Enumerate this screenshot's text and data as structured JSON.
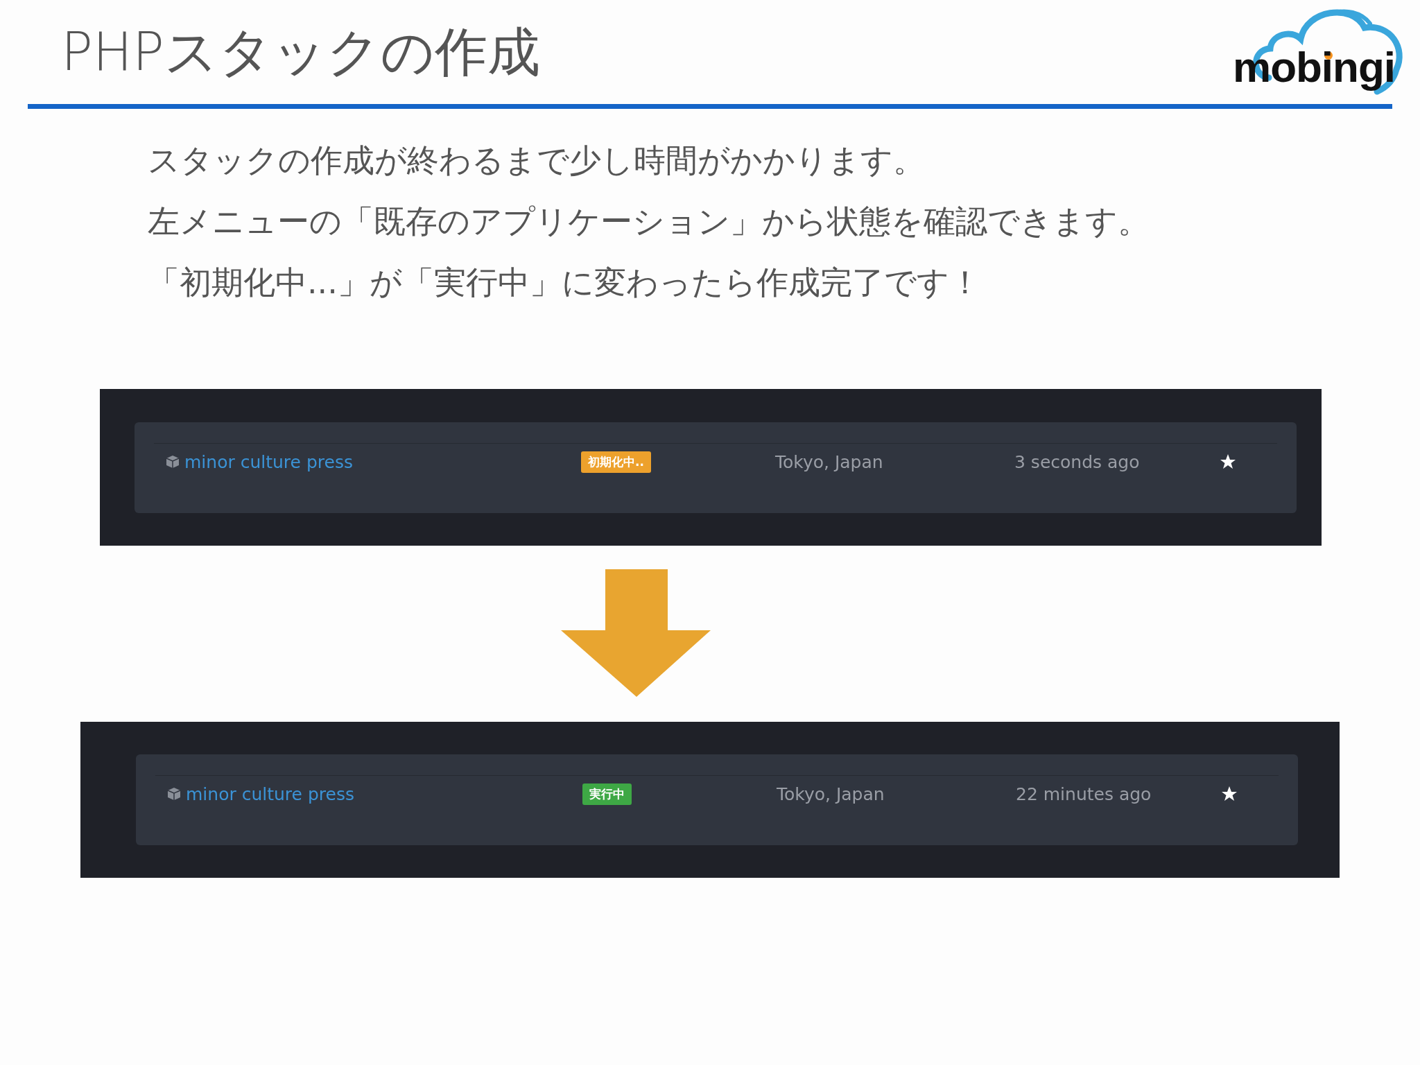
{
  "title": "PHPスタックの作成",
  "logo": {
    "text": "mobingi"
  },
  "paragraphs": [
    "スタックの作成が終わるまで少し時間がかかります。",
    "左メニューの「既存のアプリケーション」から状態を確認できます。",
    "「初期化中...」が「実行中」に変わったら作成完了です！"
  ],
  "panels": [
    {
      "name": "minor culture press",
      "status": {
        "label": "初期化中..",
        "kind": "initializing"
      },
      "location": "Tokyo, Japan",
      "time": "3 seconds ago"
    },
    {
      "name": "minor culture press",
      "status": {
        "label": "実行中",
        "kind": "running"
      },
      "location": "Tokyo, Japan",
      "time": "22 minutes ago"
    }
  ]
}
